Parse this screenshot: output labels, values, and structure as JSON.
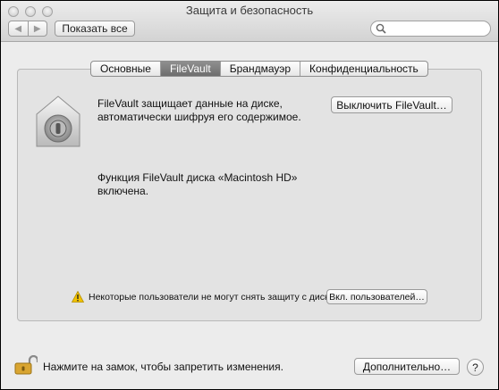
{
  "window": {
    "title": "Защита и безопасность"
  },
  "toolbar": {
    "back_glyph": "◀",
    "forward_glyph": "▶",
    "show_all_label": "Показать все",
    "search_placeholder": ""
  },
  "tabs": [
    {
      "label": "Основные",
      "active": false
    },
    {
      "label": "FileVault",
      "active": true
    },
    {
      "label": "Брандмауэр",
      "active": false
    },
    {
      "label": "Конфиденциальность",
      "active": false
    }
  ],
  "filevault": {
    "icon": "filevault-safe-icon",
    "description": "FileVault защищает данные на диске, автоматически шифруя его содержимое.",
    "turn_off_button": "Выключить FileVault…",
    "status": "Функция FileVault диска «Macintosh HD» включена.",
    "warning_icon": "warning-triangle-icon",
    "warning_text": "Некоторые пользователи не могут снять защиту с диска.",
    "enable_users_button": "Вкл. пользователей…"
  },
  "footer": {
    "lock_icon": "padlock-open-icon",
    "lock_text": "Нажмите на замок, чтобы запретить изменения.",
    "advanced_button": "Дополнительно…",
    "help_label": "?"
  },
  "colors": {
    "accent_tab": "#7a7a7a",
    "warning": "#f2c200"
  }
}
